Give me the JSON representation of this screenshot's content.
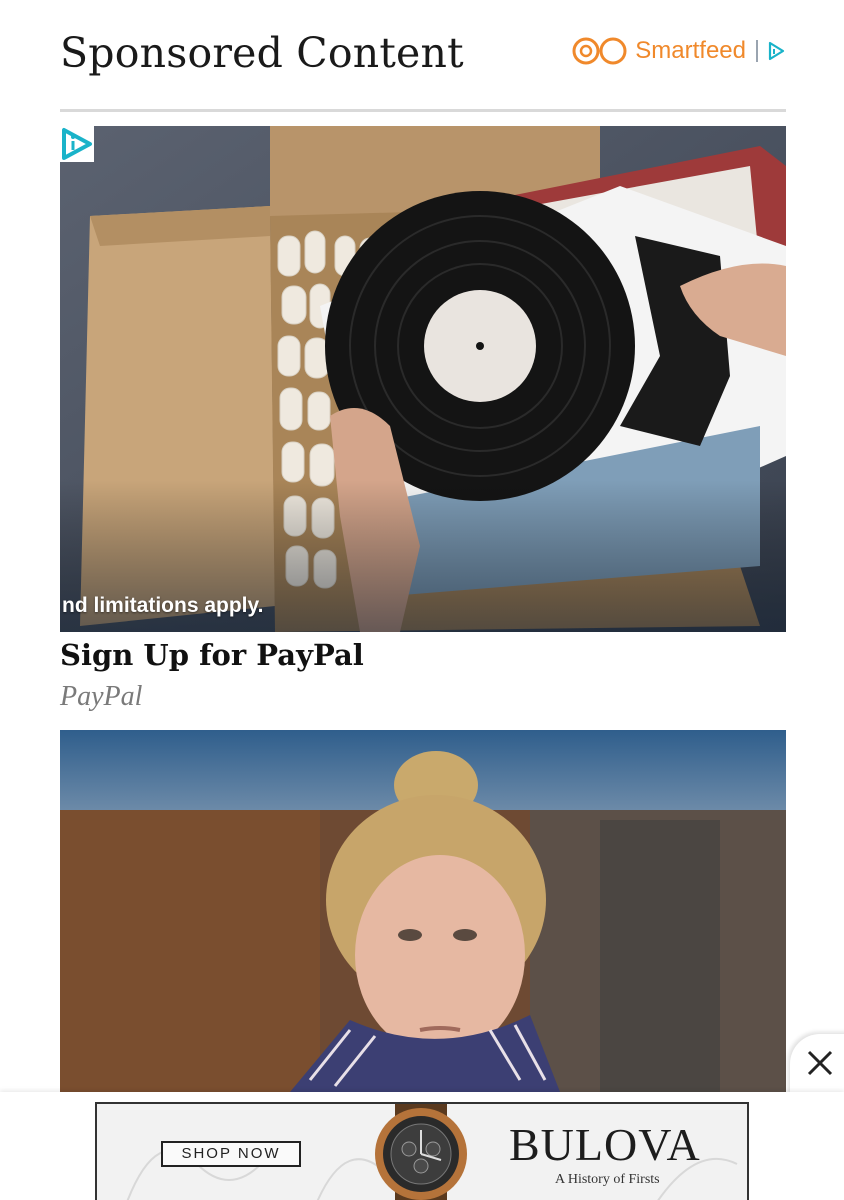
{
  "header": {
    "title": "Sponsored Content",
    "brand": "Smartfeed"
  },
  "cards": [
    {
      "image_caption": "nd limitations apply.",
      "title": "Sign Up for PayPal",
      "source": "PayPal"
    },
    {
      "image_caption": "",
      "title": "",
      "source": ""
    }
  ],
  "footer_ad": {
    "button_label": "SHOP NOW",
    "brand": "BULOVA",
    "tagline": "A History of Firsts"
  },
  "colors": {
    "brand_orange": "#f0892b",
    "adchoice_teal": "#1ab3c9"
  },
  "icons": [
    "smartfeed-logo-icon",
    "adchoices-icon",
    "ad-info-icon",
    "close-icon"
  ]
}
